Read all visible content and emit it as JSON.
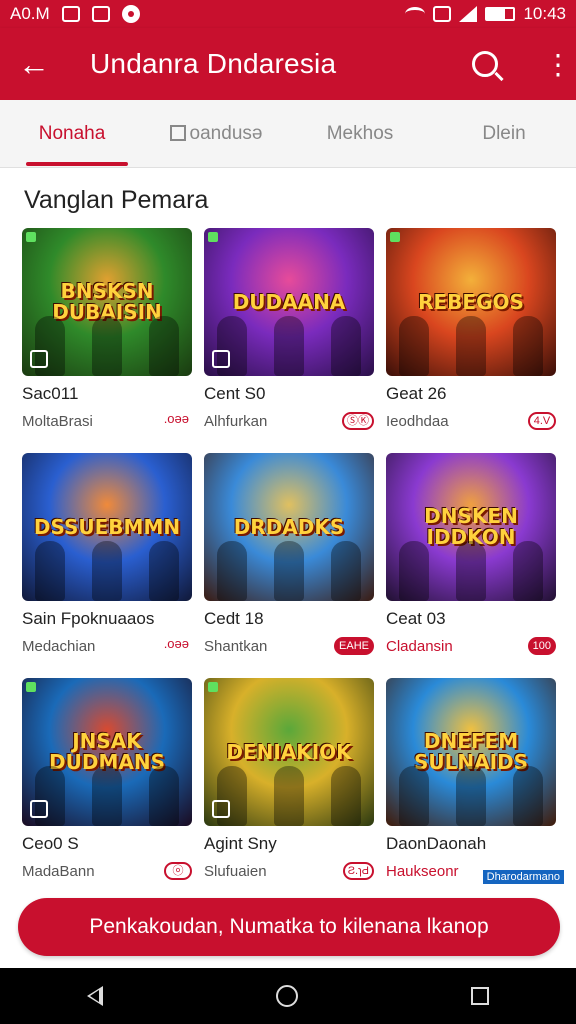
{
  "status": {
    "left_text": "A0.M",
    "time": "10:43"
  },
  "app_bar": {
    "title": "Undanra Dndaresia"
  },
  "tabs": [
    {
      "label": "Nonaha"
    },
    {
      "label": "oandusə"
    },
    {
      "label": "Mekhos"
    },
    {
      "label": "Dlein"
    }
  ],
  "section": {
    "title": "Vanglan Pemara"
  },
  "cards": [
    {
      "art_title": "BNSKSN DUBAISIN",
      "title": "Sac011",
      "subtitle": "MoltaBrasi",
      "badge": ".oəə",
      "palette": [
        "#2f8a2a",
        "#e0a030",
        "#1a3a10"
      ]
    },
    {
      "art_title": "DUDAANA",
      "title": "Cent S0",
      "subtitle": "Alhfurkan",
      "badge": "ⓈⓀ",
      "palette": [
        "#7a2bbd",
        "#e74b9a",
        "#2a0f48"
      ]
    },
    {
      "art_title": "REBEGOS",
      "title": "Geat 26",
      "subtitle": "Ieodhdaa",
      "badge": "4.V",
      "palette": [
        "#d9461f",
        "#f3b03a",
        "#3a0f08"
      ]
    },
    {
      "art_title": "DSSUEBMMN",
      "title": "Sain Fpoknuaaos",
      "subtitle": "Medachian",
      "badge": ".oəə",
      "palette": [
        "#2a5fd0",
        "#f08a3a",
        "#101838"
      ]
    },
    {
      "art_title": "DRDADKS",
      "title": "Cedt 18",
      "subtitle": "Shantkan",
      "badge": "EAHE",
      "palette": [
        "#3a8ad8",
        "#e0c060",
        "#3a1a10"
      ]
    },
    {
      "art_title": "DNSKEN IDDKON",
      "title": "Ceat 03",
      "subtitle": "Cladansin",
      "badge": "100",
      "palette": [
        "#8a3ad0",
        "#f0a040",
        "#201030"
      ]
    },
    {
      "art_title": "JNSAK DUDMANS",
      "title": "Ceo0 S",
      "subtitle": "MadaBann",
      "badge": "ⓞ",
      "palette": [
        "#1a6ab8",
        "#d84a30",
        "#1a0a20"
      ]
    },
    {
      "art_title": "DENIAKIOK",
      "title": "Agint Sny",
      "subtitle": "Slufuaien",
      "badge": "Ƨ.ɿԀ",
      "palette": [
        "#d8b02a",
        "#5aa83a",
        "#2a3810"
      ]
    },
    {
      "art_title": "DNEFEM SULNAIDS",
      "title": "DaonDaonah",
      "subtitle": "Haukseonr",
      "badge": "",
      "palette": [
        "#2a8ad8",
        "#f0c040",
        "#401a08"
      ]
    }
  ],
  "watermark": "Dharodarmano",
  "cta": {
    "label": "Penkakoudan, Numatka to kilenana lkanop"
  }
}
